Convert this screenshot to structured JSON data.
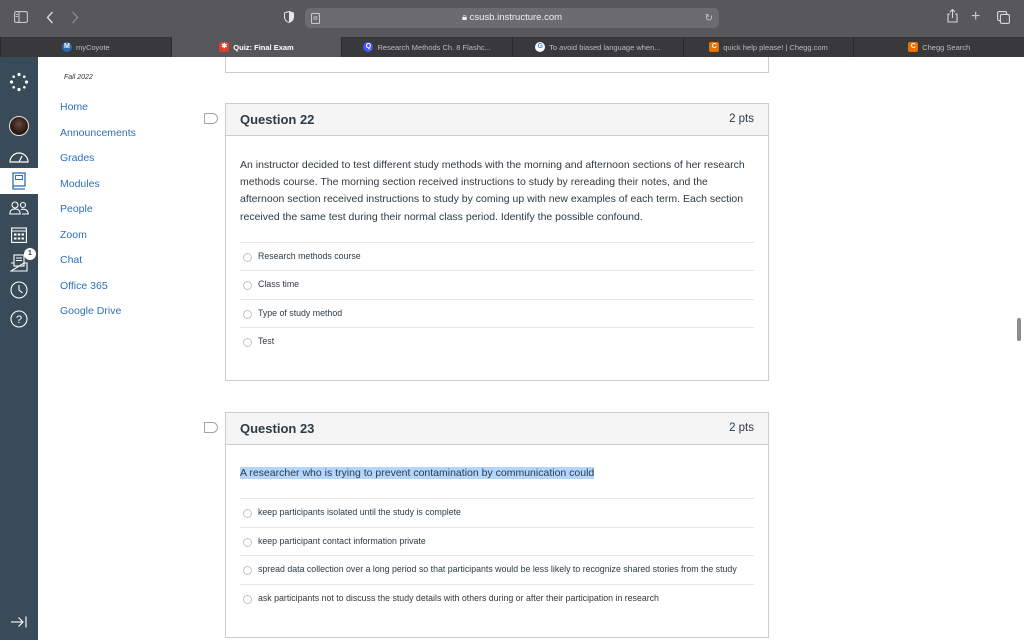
{
  "browser": {
    "url": "csusb.instructure.com",
    "icons": {
      "sidebar": "sidebar-toggle-icon",
      "back": "chevron-left-icon",
      "forward": "chevron-right-icon",
      "shield": "privacy-shield-icon",
      "reader": "reader-icon",
      "lock": "lock-icon",
      "reload": "reload-icon",
      "share": "share-icon",
      "new_tab": "plus-icon",
      "tab_overview": "tab-overview-icon"
    },
    "tabs": [
      {
        "label": "myCoyote",
        "favicon": "M",
        "favicon_color": "#2b6cb0",
        "active": false
      },
      {
        "label": "Quiz: Final Exam",
        "favicon": "✱",
        "favicon_color": "#e03e2d",
        "active": true
      },
      {
        "label": "Research Methods Ch. 8 Flashc...",
        "favicon": "Q",
        "favicon_color": "#4255ff",
        "active": false
      },
      {
        "label": "To avoid biased language when...",
        "favicon": "G",
        "favicon_color": "#4285f4",
        "active": false
      },
      {
        "label": "quick help please! | Chegg.com",
        "favicon": "C",
        "favicon_color": "#eb7100",
        "active": false
      },
      {
        "label": "Chegg Search",
        "favicon": "C",
        "favicon_color": "#eb7100",
        "active": false
      }
    ]
  },
  "global_nav": {
    "items": [
      {
        "name": "canvas-logo-icon"
      },
      {
        "name": "account-avatar"
      },
      {
        "name": "dashboard-icon"
      },
      {
        "name": "courses-icon",
        "active": true
      },
      {
        "name": "groups-icon"
      },
      {
        "name": "calendar-icon"
      },
      {
        "name": "inbox-icon",
        "badge": "1"
      },
      {
        "name": "history-icon"
      },
      {
        "name": "help-icon"
      }
    ],
    "collapse_icon": "collapse-arrow-icon"
  },
  "course_nav": {
    "term": "Fall 2022",
    "links": [
      "Home",
      "Announcements",
      "Grades",
      "Modules",
      "People",
      "Zoom",
      "Chat",
      "Office 365",
      "Google Drive"
    ]
  },
  "questions": [
    {
      "title": "Question 22",
      "points": "2 pts",
      "text": "An instructor decided to test different study methods with the morning and afternoon sections of her research methods course. The morning section received instructions to study by rereading their notes, and the afternoon section received instructions to study by coming up with new examples of each term. Each section received the same test during their normal class period. Identify the possible confound.",
      "answers": [
        "Research methods course",
        "Class time",
        "Type of study method",
        "Test"
      ]
    },
    {
      "title": "Question 23",
      "points": "2 pts",
      "text": "A researcher who is trying to prevent contamination by communication could",
      "text_highlighted": true,
      "answers": [
        "keep participants isolated until the study is complete",
        "keep participant contact information private",
        "spread data collection over a long period so that participants would be less likely to recognize shared stories from the study",
        "ask participants not to discuss the study details with others during or after their participation in research"
      ]
    }
  ]
}
